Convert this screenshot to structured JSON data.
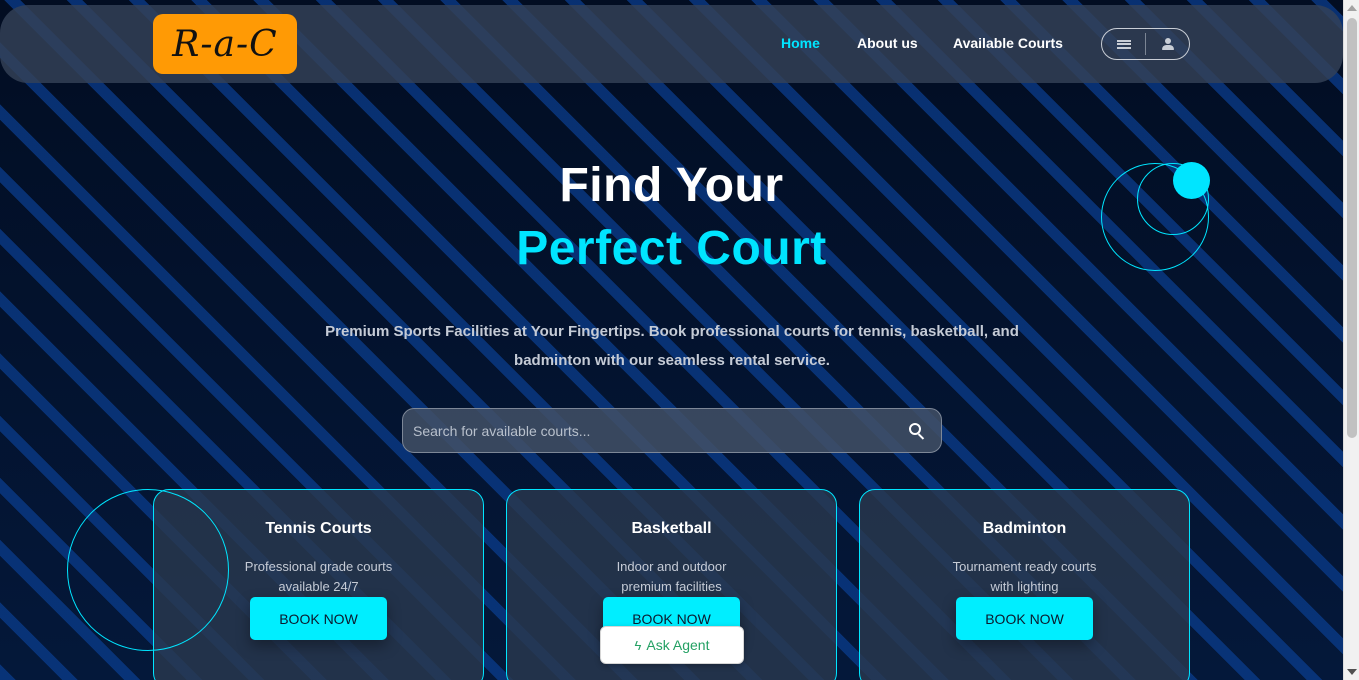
{
  "brand": {
    "logo_text": "R-a-C"
  },
  "nav": {
    "links": [
      {
        "label": "Home",
        "active": true
      },
      {
        "label": "About us",
        "active": false
      },
      {
        "label": "Available Courts",
        "active": false
      }
    ],
    "menu_icon": "hamburger-icon",
    "user_icon": "user-icon"
  },
  "hero": {
    "title_line1": "Find Your",
    "title_line2": "Perfect Court",
    "subtitle": "Premium Sports Facilities at Your Fingertips. Book professional courts for tennis, basketball, and badminton with our seamless rental service."
  },
  "search": {
    "placeholder": "Search for available courts...",
    "value": "",
    "icon": "search-icon"
  },
  "cards": [
    {
      "title": "Tennis Courts",
      "description": "Professional grade courts available 24/7",
      "button": "BOOK NOW"
    },
    {
      "title": "Basketball",
      "description": "Indoor and outdoor premium facilities",
      "button": "BOOK NOW"
    },
    {
      "title": "Badminton",
      "description": "Tournament ready courts with lighting",
      "button": "BOOK NOW"
    }
  ],
  "agent": {
    "label": "Ask Agent",
    "icon": "bolt-icon"
  },
  "colors": {
    "accent": "#00e5ff",
    "logo_bg": "#ff9a05",
    "background": "#03142e",
    "agent_text": "#23a063"
  }
}
